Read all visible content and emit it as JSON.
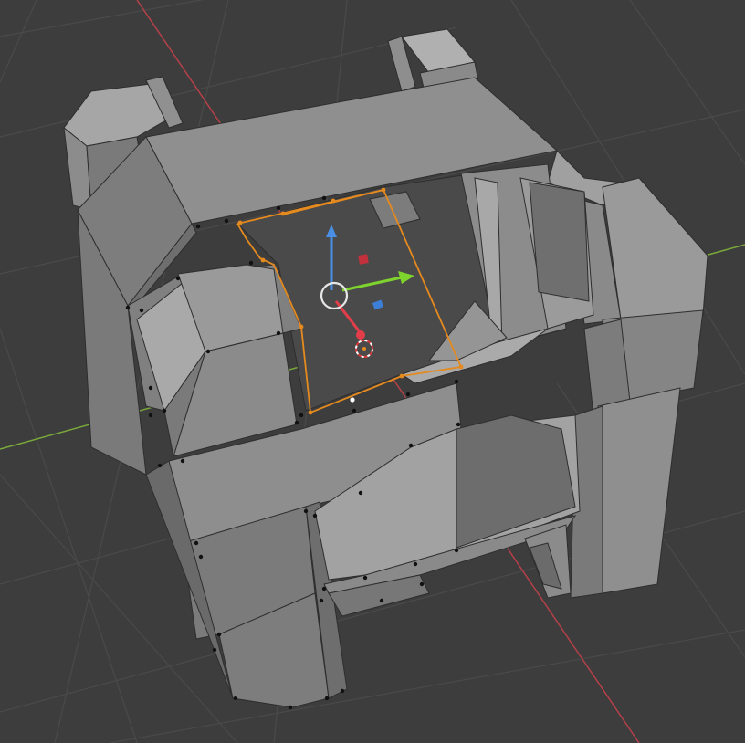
{
  "viewport": {
    "mode": "edit",
    "background_color": "#3d3d3d",
    "grid_color": "#4a4a4a",
    "x_axis_color": "#b5404a",
    "y_axis_color": "#7aa83a",
    "mesh_light": "#9c9c9c",
    "mesh_mid": "#828282",
    "mesh_dark": "#6b6b6b",
    "selection_color": "#e58a1f",
    "gizmo": {
      "x_axis_color": "#7fd32d",
      "y_axis_color": "#4a8fe6",
      "z_axis_color": "#e33d4a",
      "plane_handles": [
        "red-square",
        "blue-square"
      ]
    },
    "cursor_3d": "red-white-dashed-ring"
  }
}
